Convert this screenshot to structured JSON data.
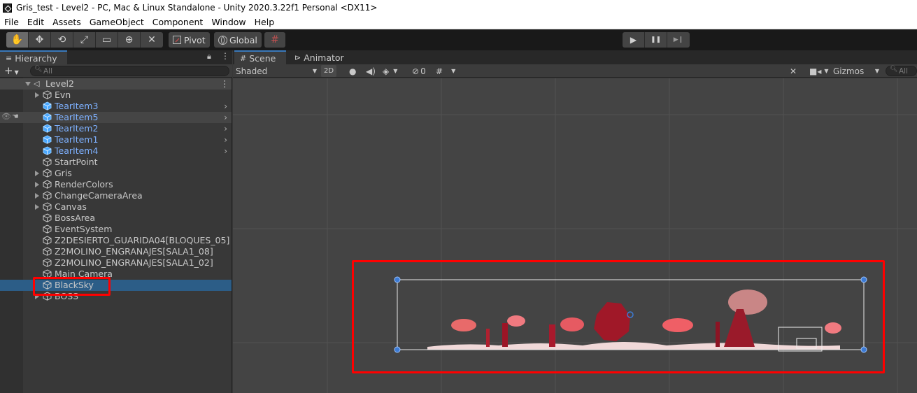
{
  "window": {
    "title": "Gris_test - Level2 - PC, Mac & Linux Standalone - Unity 2020.3.22f1 Personal <DX11>"
  },
  "menu": [
    "File",
    "Edit",
    "Assets",
    "GameObject",
    "Component",
    "Window",
    "Help"
  ],
  "toolbar": {
    "tools": [
      {
        "name": "hand-tool-icon",
        "glyph": "✋",
        "active": true
      },
      {
        "name": "move-tool-icon",
        "glyph": "✥",
        "active": false
      },
      {
        "name": "rotate-tool-icon",
        "glyph": "⟲",
        "active": false
      },
      {
        "name": "scale-tool-icon",
        "glyph": "⤢",
        "active": false
      },
      {
        "name": "rect-tool-icon",
        "glyph": "▭",
        "active": false
      },
      {
        "name": "transform-tool-icon",
        "glyph": "⊕",
        "active": false
      },
      {
        "name": "custom-tool-icon",
        "glyph": "✕",
        "active": false
      }
    ],
    "pivot_label": "Pivot",
    "global_label": "Global",
    "play_glyph": "▶",
    "pause_glyph": "❚❚",
    "step_glyph": "▶❙"
  },
  "hierarchy": {
    "tab_label": "Hierarchy",
    "add_label": "+",
    "search_placeholder": "All",
    "scene_name": "Level2",
    "items": [
      {
        "label": "Evn",
        "foldout": true,
        "prefab": false,
        "chevron": false
      },
      {
        "label": "TearItem3",
        "foldout": false,
        "prefab": true,
        "chevron": true
      },
      {
        "label": "TearItem5",
        "foldout": false,
        "prefab": true,
        "chevron": true
      },
      {
        "label": "TearItem2",
        "foldout": false,
        "prefab": true,
        "chevron": true
      },
      {
        "label": "TearItem1",
        "foldout": false,
        "prefab": true,
        "chevron": true
      },
      {
        "label": "TearItem4",
        "foldout": false,
        "prefab": true,
        "chevron": true
      },
      {
        "label": "StartPoint",
        "foldout": false,
        "prefab": false,
        "chevron": false
      },
      {
        "label": "Gris",
        "foldout": true,
        "prefab": false,
        "chevron": false
      },
      {
        "label": "RenderColors",
        "foldout": true,
        "prefab": false,
        "chevron": false
      },
      {
        "label": "ChangeCameraArea",
        "foldout": true,
        "prefab": false,
        "chevron": false
      },
      {
        "label": "Canvas",
        "foldout": true,
        "prefab": false,
        "chevron": false
      },
      {
        "label": "BossArea",
        "foldout": false,
        "prefab": false,
        "chevron": false
      },
      {
        "label": "EventSystem",
        "foldout": false,
        "prefab": false,
        "chevron": false
      },
      {
        "label": "Z2DESIERTO_GUARIDA04[BLOQUES_05]",
        "foldout": false,
        "prefab": false,
        "chevron": false
      },
      {
        "label": "Z2MOLINO_ENGRANAJES[SALA1_08]",
        "foldout": false,
        "prefab": false,
        "chevron": false
      },
      {
        "label": "Z2MOLINO_ENGRANAJES[SALA1_02]",
        "foldout": false,
        "prefab": false,
        "chevron": false
      },
      {
        "label": "Main Camera",
        "foldout": false,
        "prefab": false,
        "chevron": false
      },
      {
        "label": "BlackSky",
        "foldout": false,
        "prefab": false,
        "chevron": false,
        "selected": true
      },
      {
        "label": "BOSS",
        "foldout": true,
        "prefab": false,
        "chevron": false
      }
    ]
  },
  "scene": {
    "tabs": [
      "Scene",
      "Animator"
    ],
    "shading_mode": "Shaded",
    "mode_2d": "2D",
    "hidden_count": "0",
    "gizmos_label": "Gizmos",
    "search_placeholder": "All"
  },
  "colors": {
    "selection": "#2c5d87",
    "highlight": "#ff0000",
    "prefab_text": "#7eb1ff",
    "accent": "#3a79bb"
  }
}
